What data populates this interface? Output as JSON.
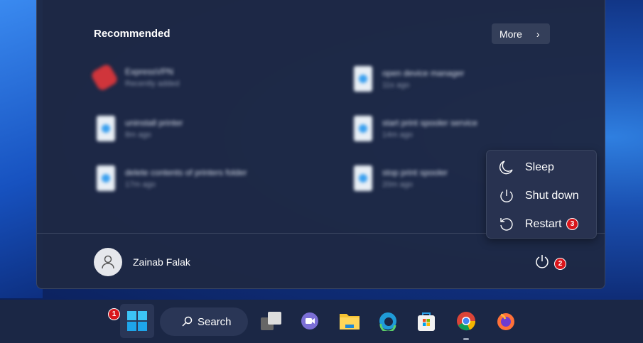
{
  "start_menu": {
    "recommended_title": "Recommended",
    "more_label": "More",
    "items": [
      {
        "name": "ExpressVPN",
        "sub": "Recently added"
      },
      {
        "name": "open device manager",
        "sub": "11s ago"
      },
      {
        "name": "uninstall printer",
        "sub": "8m ago"
      },
      {
        "name": "start print spooler service",
        "sub": "14m ago"
      },
      {
        "name": "delete contents of printers folder",
        "sub": "17m ago"
      },
      {
        "name": "stop print spooler",
        "sub": "20m ago"
      }
    ],
    "user_name": "Zainab Falak"
  },
  "power_menu": {
    "items": [
      "Sleep",
      "Shut down",
      "Restart"
    ]
  },
  "badges": {
    "start": "1",
    "power": "2",
    "restart": "3"
  },
  "taskbar": {
    "search_label": "Search"
  }
}
